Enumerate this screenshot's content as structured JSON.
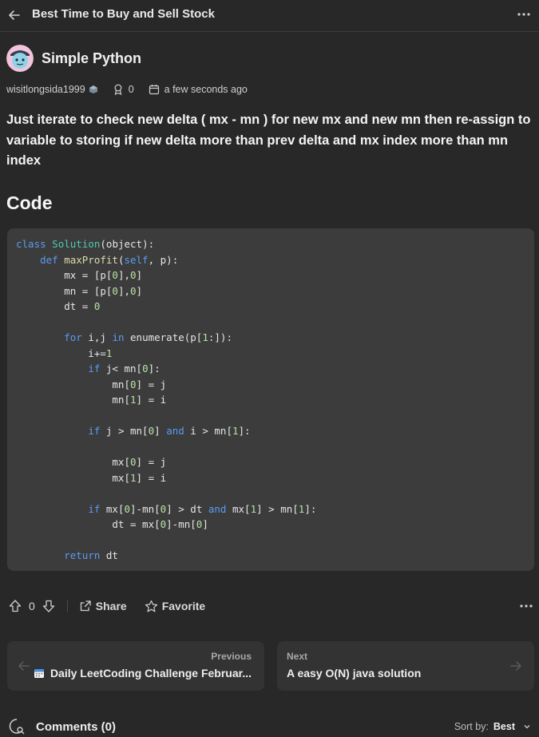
{
  "header": {
    "title": "Best Time to Buy and Sell Stock"
  },
  "author": {
    "name": "Simple Python",
    "username": "wisitlongsida1999",
    "reputation": "0",
    "posted": "a few seconds ago"
  },
  "summary": "Just iterate to check new delta ( mx - mn ) for new mx and new mn then re-assign to variable to storing if new delta more than prev delta and mx index more than mn index",
  "code_heading": "Code",
  "actions": {
    "votes": "0",
    "share": "Share",
    "favorite": "Favorite"
  },
  "nav": {
    "prev_label": "Previous",
    "prev_title": "Daily LeetCoding Challenge Februar...",
    "next_label": "Next",
    "next_title": "A easy O(N) java solution"
  },
  "comments": {
    "title": "Comments (0)",
    "sort_label": "Sort by:",
    "sort_value": "Best"
  }
}
